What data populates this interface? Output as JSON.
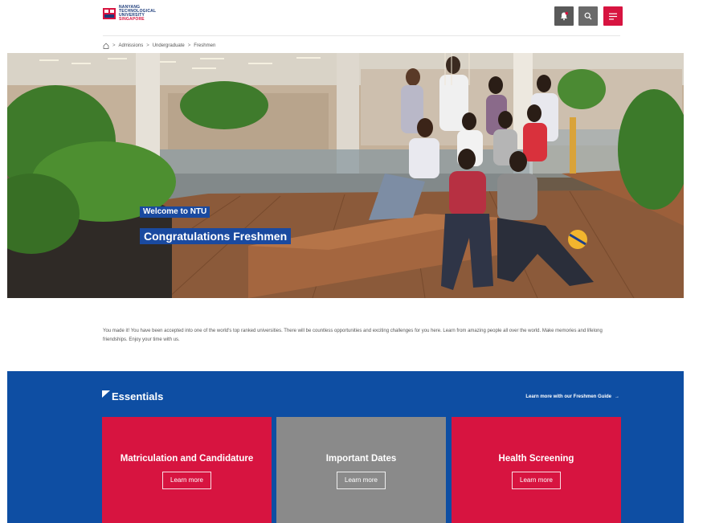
{
  "header": {
    "logo": {
      "line1": "NANYANG",
      "line2": "TECHNOLOGICAL",
      "line3": "UNIVERSITY",
      "line4": "SINGAPORE"
    },
    "buttons": {
      "notifications_icon": "bell-icon",
      "search_icon": "search-icon",
      "menu_icon": "hamburger-menu-icon"
    },
    "colors": {
      "accent": "#d71440",
      "brand_blue": "#1c3b7a"
    }
  },
  "breadcrumb": {
    "home_icon": "home-icon",
    "items": [
      "Admissions",
      "Undergraduate",
      "Freshmen"
    ],
    "separator": ">"
  },
  "hero": {
    "kicker": "Welcome to NTU",
    "title": "Congratulations Freshmen"
  },
  "intro": {
    "text": "You made it! You have been accepted into one of the world's top ranked universities. There will be countless opportunities and exciting challenges for you here. Learn from amazing people all over the world. Make memories and lifelong friendships. Enjoy your time with us."
  },
  "essentials": {
    "title": "Essentials",
    "guide_link": "Learn more with our Freshmen Guide",
    "guide_arrow": "→",
    "background": "#0e4ea3",
    "cards": [
      {
        "title": "Matriculation and Candidature",
        "button": "Learn more",
        "color": "#d71440"
      },
      {
        "title": "Important Dates",
        "button": "Learn more",
        "color": "#8a8a8a"
      },
      {
        "title": "Health Screening",
        "button": "Learn more",
        "color": "#d71440"
      }
    ]
  }
}
